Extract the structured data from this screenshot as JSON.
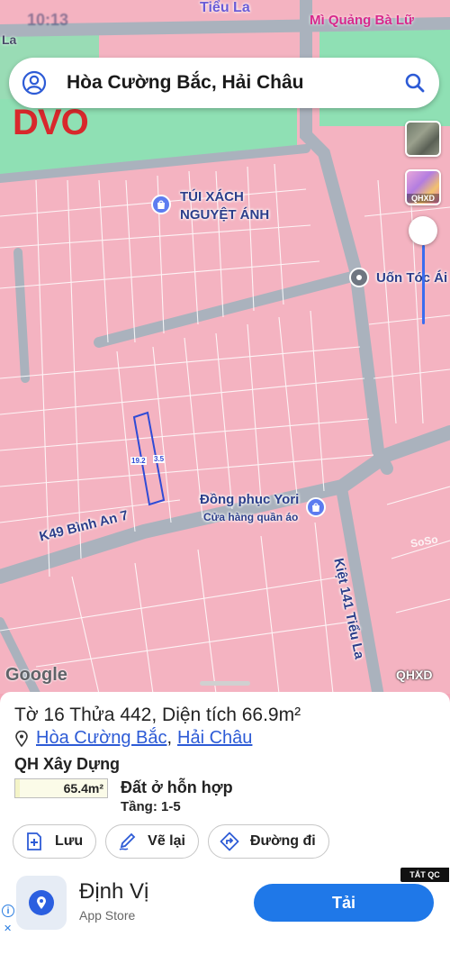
{
  "status": {
    "time": "10:13"
  },
  "map": {
    "top_street": "Tiểu La",
    "top_shop": "Mì Quảng Bà Lữ",
    "top_left_fragment": "La",
    "brand_fragment": "DVO",
    "search_title": "Hòa Cường Bắc, Hải Châu",
    "layers": {
      "qhxd_label": "QHXD"
    },
    "pois": [
      {
        "name_line1": "TÚI XÁCH",
        "name_line2": "NGUYỆT ÁNH",
        "icon": "shopping-bag-icon"
      },
      {
        "name_line1": "Uốn Tóc Ái",
        "icon": "place-pin-icon"
      },
      {
        "name_line1": "Đồng phục Yori",
        "name_line2": "Cửa hàng quần áo",
        "icon": "shopping-bag-icon"
      }
    ],
    "streets": {
      "binh_an": "K49 Bình An 7",
      "kiet": "Kiệt 141 Tiểu La"
    },
    "parcel": {
      "length": "19.2",
      "width": "3.5"
    },
    "google": "Google",
    "qhxd_corner": "QHXD",
    "watermark": "SoSo"
  },
  "sheet": {
    "plot_title": "Tờ 16 Thửa 442, Diện tích 66.9m²",
    "ward": "Hòa Cường Bắc",
    "district": "Hải Châu",
    "planning_title": "QH Xây Dựng",
    "zone_area": "65.4m²",
    "zone_color": "#f4f4c8",
    "zone_name": "Đất ở hỗn hợp",
    "floors": "Tầng: 1-5",
    "actions": [
      {
        "label": "Lưu",
        "icon": "save-plus-icon"
      },
      {
        "label": "Vẽ lại",
        "icon": "redraw-pen-icon"
      },
      {
        "label": "Đường đi",
        "icon": "directions-icon"
      }
    ]
  },
  "ad": {
    "tag": "TẮT QC",
    "app_name": "Định Vị",
    "store": "App Store",
    "cta": "Tải",
    "cta_color": "#1f78e8"
  }
}
